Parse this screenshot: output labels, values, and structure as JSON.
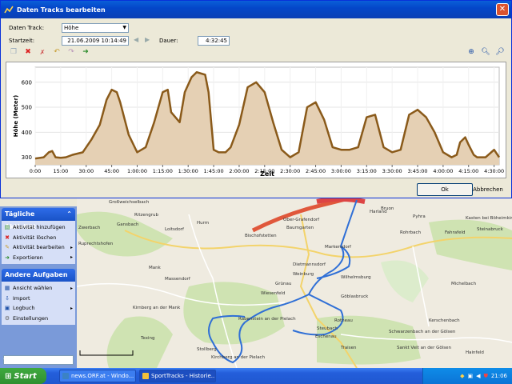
{
  "dialog": {
    "title": "Daten Tracks bearbeiten",
    "daten_track_label": "Daten Track:",
    "daten_track_value": "Höhe",
    "startzeit_label": "Startzeit:",
    "startzeit_value": "21.06.2009 10:14:49",
    "dauer_label": "Dauer:",
    "dauer_value": "4:32:45",
    "ok_label": "Ok",
    "cancel_label": "Abbrechen",
    "toolbar_icons": [
      "copy-icon",
      "delete-icon",
      "delete-selection-icon",
      "undo-icon",
      "redo-icon",
      "export-icon"
    ],
    "zoom_icons": [
      "zoom-fit-icon",
      "zoom-in-icon",
      "zoom-out-icon"
    ]
  },
  "chart_data": {
    "type": "area",
    "xlabel": "Zeit",
    "ylabel": "Höhe (Meter)",
    "ylim": [
      270,
      660
    ],
    "yticks": [
      300,
      400,
      500,
      600
    ],
    "xtick_labels": [
      "0:00",
      "15:00",
      "30:00",
      "45:00",
      "1:00:00",
      "1:15:00",
      "1:30:00",
      "1:45:00",
      "2:00:00",
      "2:15:00",
      "2:30:00",
      "2:45:00",
      "3:00:00",
      "3:15:00",
      "3:30:00",
      "3:45:00",
      "4:00:00",
      "4:15:00",
      "4:30:00"
    ],
    "x_minutes": [
      0,
      5,
      8,
      10,
      12,
      15,
      18,
      22,
      28,
      33,
      38,
      42,
      45,
      48,
      50,
      55,
      60,
      65,
      70,
      75,
      78,
      80,
      85,
      88,
      92,
      95,
      100,
      102,
      105,
      108,
      112,
      115,
      120,
      125,
      130,
      135,
      140,
      145,
      150,
      155,
      160,
      165,
      170,
      175,
      180,
      185,
      190,
      195,
      200,
      205,
      210,
      215,
      220,
      225,
      230,
      235,
      240,
      245,
      248,
      250,
      253,
      255,
      258,
      260,
      265,
      270,
      273
    ],
    "y_values": [
      295,
      300,
      320,
      325,
      300,
      298,
      300,
      310,
      320,
      370,
      430,
      530,
      570,
      560,
      520,
      390,
      320,
      340,
      440,
      560,
      570,
      480,
      440,
      560,
      620,
      640,
      630,
      560,
      330,
      320,
      320,
      340,
      430,
      580,
      600,
      560,
      440,
      330,
      300,
      320,
      500,
      520,
      450,
      340,
      330,
      330,
      340,
      460,
      470,
      340,
      320,
      330,
      470,
      490,
      460,
      400,
      320,
      300,
      310,
      360,
      380,
      350,
      310,
      300,
      300,
      330,
      300
    ],
    "colors": {
      "line": "#8a5a1a",
      "fill": "#e5d0b4"
    }
  },
  "sidebar": {
    "daily_title": "Tägliche Aktivität",
    "daily_items": [
      "Aktivität hinzufügen",
      "Aktivität löschen",
      "Aktivität bearbeiten",
      "Exportieren"
    ],
    "other_title": "Andere Aufgaben",
    "other_items": [
      "Ansicht wählen",
      "Import",
      "Logbuch",
      "Einstellungen"
    ]
  },
  "map": {
    "labels": [
      "Großweichselbach",
      "Ritzengrub",
      "Zwerbach",
      "Gansbach",
      "Ruprechtshofen",
      "Loitsdorf",
      "Bischofstetten",
      "Baumgarten",
      "Ober-Grafendorf",
      "Hurm",
      "Markersdorf",
      "Massendorf",
      "Kirnberg an der Mank",
      "Texing",
      "Weinburg",
      "Grünau",
      "Rabenstein an der Pielach",
      "Wilhelmsburg",
      "Göblasbruck",
      "Kirchberg an der Pielach",
      "Eschenau",
      "Traisen",
      "Schwarzenbach an der Gölsen",
      "Michelbach",
      "Pyhra",
      "Kasten bei Böheimkirchen",
      "Steinabruck",
      "Fahrafeld",
      "Sankt Veit an der Gölsen",
      "Hainfeld",
      "Rotheau",
      "Mank",
      "Dietmannsdorf",
      "Rohrbach",
      "Steubach",
      "Bruon",
      "Harland",
      "Stollberg",
      "Wiesenfeld",
      "Kerschenbach"
    ]
  },
  "taskbar": {
    "start_label": "Start",
    "tasks": [
      "news.ORF.at - Windo...",
      "SportTracks - Historie..."
    ],
    "lang": "DE",
    "clock": "21:06"
  }
}
